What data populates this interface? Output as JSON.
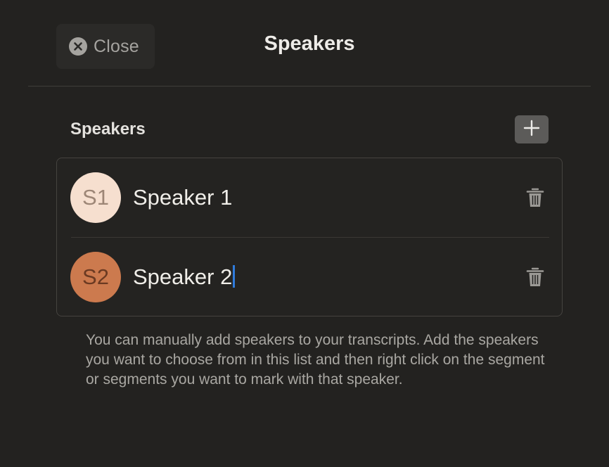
{
  "header": {
    "close_icon": "close-circle-icon",
    "close_label": "Close",
    "title": "Speakers"
  },
  "section": {
    "title": "Speakers",
    "add_icon": "plus-icon"
  },
  "speakers": [
    {
      "initials": "S1",
      "name": "Speaker 1",
      "avatar_color": "#f6dfcf",
      "delete_icon": "trash-icon"
    },
    {
      "initials": "S2",
      "name": "Speaker 2",
      "avatar_color": "#cc7a4e",
      "delete_icon": "trash-icon",
      "editing": true
    }
  ],
  "help_text": "You can manually add speakers to your transcripts. Add the speakers you want to choose from in this list and then right click on the segment or segments you want to mark with that speaker.",
  "colors": {
    "background": "#232220",
    "caret": "#2f7bdc",
    "add_button": "#5c5b59"
  }
}
